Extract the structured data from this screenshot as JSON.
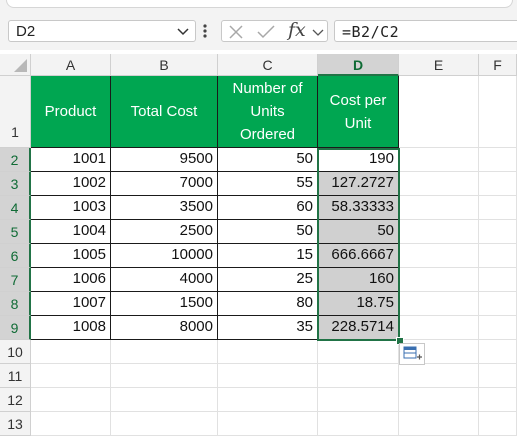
{
  "formula_bar": {
    "name_box": "D2",
    "formula": "=B2/C2",
    "fx_label": "fx"
  },
  "columns": [
    "A",
    "B",
    "C",
    "D",
    "E",
    "F"
  ],
  "rows": [
    "1",
    "2",
    "3",
    "4",
    "5",
    "6",
    "7",
    "8",
    "9",
    "10",
    "11",
    "12",
    "13"
  ],
  "table": {
    "headers": [
      "Product",
      "Total Cost",
      "Number of Units Ordered",
      "Cost per Unit"
    ],
    "header_lines": {
      "c": [
        "Number of",
        "Units",
        "Ordered"
      ],
      "d": [
        "Cost per",
        "Unit"
      ]
    },
    "rows": [
      {
        "product": "1001",
        "total_cost": "9500",
        "units": "50",
        "cost_per_unit": "190"
      },
      {
        "product": "1002",
        "total_cost": "7000",
        "units": "55",
        "cost_per_unit": "127.2727"
      },
      {
        "product": "1003",
        "total_cost": "3500",
        "units": "60",
        "cost_per_unit": "58.33333"
      },
      {
        "product": "1004",
        "total_cost": "2500",
        "units": "50",
        "cost_per_unit": "50"
      },
      {
        "product": "1005",
        "total_cost": "10000",
        "units": "15",
        "cost_per_unit": "666.6667"
      },
      {
        "product": "1006",
        "total_cost": "4000",
        "units": "25",
        "cost_per_unit": "160"
      },
      {
        "product": "1007",
        "total_cost": "1500",
        "units": "80",
        "cost_per_unit": "18.75"
      },
      {
        "product": "1008",
        "total_cost": "8000",
        "units": "35",
        "cost_per_unit": "228.5714"
      }
    ]
  },
  "colors": {
    "header_fill": "#00a651",
    "selection_accent": "#217346",
    "filled_range": "#d0d0d0"
  }
}
